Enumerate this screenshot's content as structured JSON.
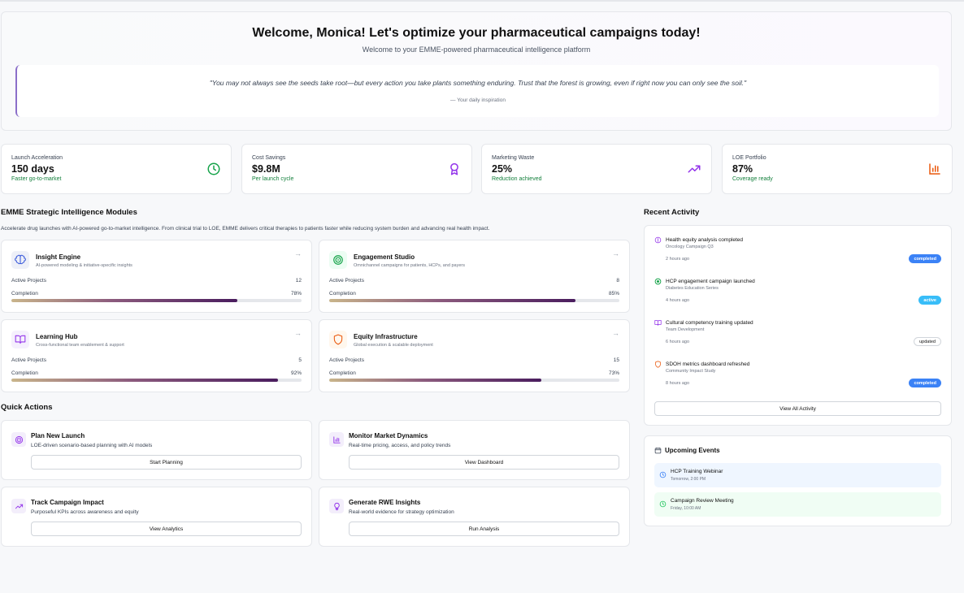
{
  "hero": {
    "title": "Welcome, Monica! Let's optimize your pharmaceutical campaigns today!",
    "subtitle": "Welcome to your EMME-powered pharmaceutical intelligence platform",
    "quote": "\"You may not always see the seeds take root—but every action you take plants something enduring. Trust that the forest is growing, even if right now you can only see the soil.\"",
    "quote_attribution": "— Your daily inspiration"
  },
  "stats": [
    {
      "label": "Launch Acceleration",
      "value": "150 days",
      "note": "Faster go-to-market",
      "icon": "clock-icon",
      "color": "#16a34a"
    },
    {
      "label": "Cost Savings",
      "value": "$9.8M",
      "note": "Per launch cycle",
      "icon": "award-icon",
      "color": "#9333ea"
    },
    {
      "label": "Marketing Waste",
      "value": "25%",
      "note": "Reduction achieved",
      "icon": "trending-up-icon",
      "color": "#9333ea"
    },
    {
      "label": "LOE Portfolio",
      "value": "87%",
      "note": "Coverage ready",
      "icon": "bar-chart-icon",
      "color": "#ea580c"
    }
  ],
  "modules": {
    "title": "EMME Strategic Intelligence Modules",
    "description": "Accelerate drug launches with AI-powered go-to-market intelligence. From clinical trial to LOE, EMME delivers critical therapies to patients faster while reducing system burden and advancing real health impact.",
    "items": [
      {
        "name": "Insight Engine",
        "desc": "AI-powered modeling & initiative-specific insights",
        "projects_label": "Active Projects",
        "projects": "12",
        "completion_label": "Completion",
        "completion": "78%",
        "completion_fraction": 0.78,
        "icon": "brain-icon"
      },
      {
        "name": "Engagement Studio",
        "desc": "Omnichannel campaigns for patients, HCPs, and payers",
        "projects_label": "Active Projects",
        "projects": "8",
        "completion_label": "Completion",
        "completion": "85%",
        "completion_fraction": 0.85,
        "icon": "target-icon"
      },
      {
        "name": "Learning Hub",
        "desc": "Cross-functional team enablement & support",
        "projects_label": "Active Projects",
        "projects": "5",
        "completion_label": "Completion",
        "completion": "92%",
        "completion_fraction": 0.92,
        "icon": "book-icon"
      },
      {
        "name": "Equity Infrastructure",
        "desc": "Global execution & scalable deployment",
        "projects_label": "Active Projects",
        "projects": "15",
        "completion_label": "Completion",
        "completion": "73%",
        "completion_fraction": 0.73,
        "icon": "shield-icon"
      }
    ],
    "arrow": "→"
  },
  "quick_actions": {
    "title": "Quick Actions",
    "items": [
      {
        "title": "Plan New Launch",
        "desc": "LOE-driven scenario-based planning with AI models",
        "button": "Start Planning",
        "icon": "target-icon"
      },
      {
        "title": "Monitor Market Dynamics",
        "desc": "Real-time pricing, access, and policy trends",
        "button": "View Dashboard",
        "icon": "bar-chart-icon"
      },
      {
        "title": "Track Campaign Impact",
        "desc": "Purposeful KPIs across awareness and equity",
        "button": "View Analytics",
        "icon": "trending-up-icon"
      },
      {
        "title": "Generate RWE Insights",
        "desc": "Real-world evidence for strategy optimization",
        "button": "Run Analysis",
        "icon": "lightbulb-icon"
      }
    ]
  },
  "activity": {
    "title": "Recent Activity",
    "items": [
      {
        "title": "Health equity analysis completed",
        "sub": "Oncology Campaign Q3",
        "time": "2 hours ago",
        "status": "completed",
        "icon": "brain-icon"
      },
      {
        "title": "HCP engagement campaign launched",
        "sub": "Diabetes Education Series",
        "time": "4 hours ago",
        "status": "active",
        "icon": "target-icon"
      },
      {
        "title": "Cultural competency training updated",
        "sub": "Team Development",
        "time": "6 hours ago",
        "status": "updated",
        "icon": "book-icon"
      },
      {
        "title": "SDOH metrics dashboard refreshed",
        "sub": "Community Impact Study",
        "time": "8 hours ago",
        "status": "completed",
        "icon": "shield-icon"
      }
    ],
    "view_all": "View All Activity"
  },
  "events": {
    "title": "Upcoming Events",
    "items": [
      {
        "title": "HCP Training Webinar",
        "when": "Tomorrow, 2:00 PM",
        "bg": "#eff6ff",
        "color": "#3b82f6"
      },
      {
        "title": "Campaign Review Meeting",
        "when": "Friday, 10:00 AM",
        "bg": "#f0fdf4",
        "color": "#22c55e"
      }
    ]
  }
}
